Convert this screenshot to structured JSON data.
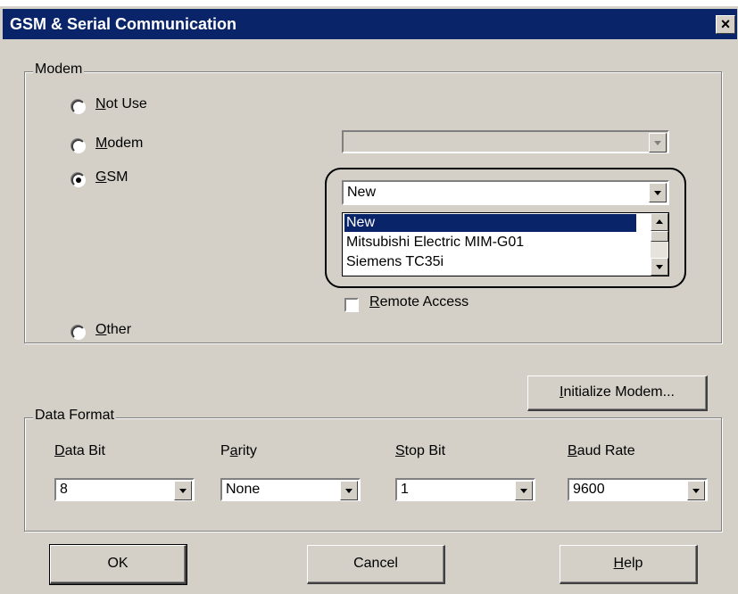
{
  "window": {
    "title": "GSM & Serial Communication",
    "close_label": "×"
  },
  "modem_group": {
    "label": "Modem",
    "options": [
      {
        "key": "N",
        "rest": "ot Use",
        "checked": false
      },
      {
        "key": "M",
        "rest": "odem",
        "checked": false
      },
      {
        "key": "G",
        "rest": "SM",
        "checked": true
      },
      {
        "key": "O",
        "rest": "ther",
        "checked": false
      }
    ],
    "modem_combo_value": "",
    "gsm_combo_value": "New",
    "gsm_list_items": [
      "New",
      "Mitsubishi Electric MIM-G01",
      "Siemens TC35i"
    ],
    "gsm_selected_index": 0,
    "remote_access": {
      "key": "R",
      "rest": "emote Access",
      "checked": false
    }
  },
  "initialize_button": {
    "key": "I",
    "rest": "nitialize Modem..."
  },
  "data_format": {
    "label": "Data Format",
    "fields": [
      {
        "pre": "",
        "key": "D",
        "rest": "ata Bit",
        "value": "8"
      },
      {
        "pre": "P",
        "key": "a",
        "rest": "rity",
        "value": "None"
      },
      {
        "pre": "",
        "key": "S",
        "rest": "top Bit",
        "value": "1"
      },
      {
        "pre": "",
        "key": "B",
        "rest": "aud Rate",
        "value": "9600"
      }
    ]
  },
  "buttons": {
    "ok": "OK",
    "cancel": "Cancel",
    "help": {
      "key": "H",
      "rest": "elp"
    }
  }
}
